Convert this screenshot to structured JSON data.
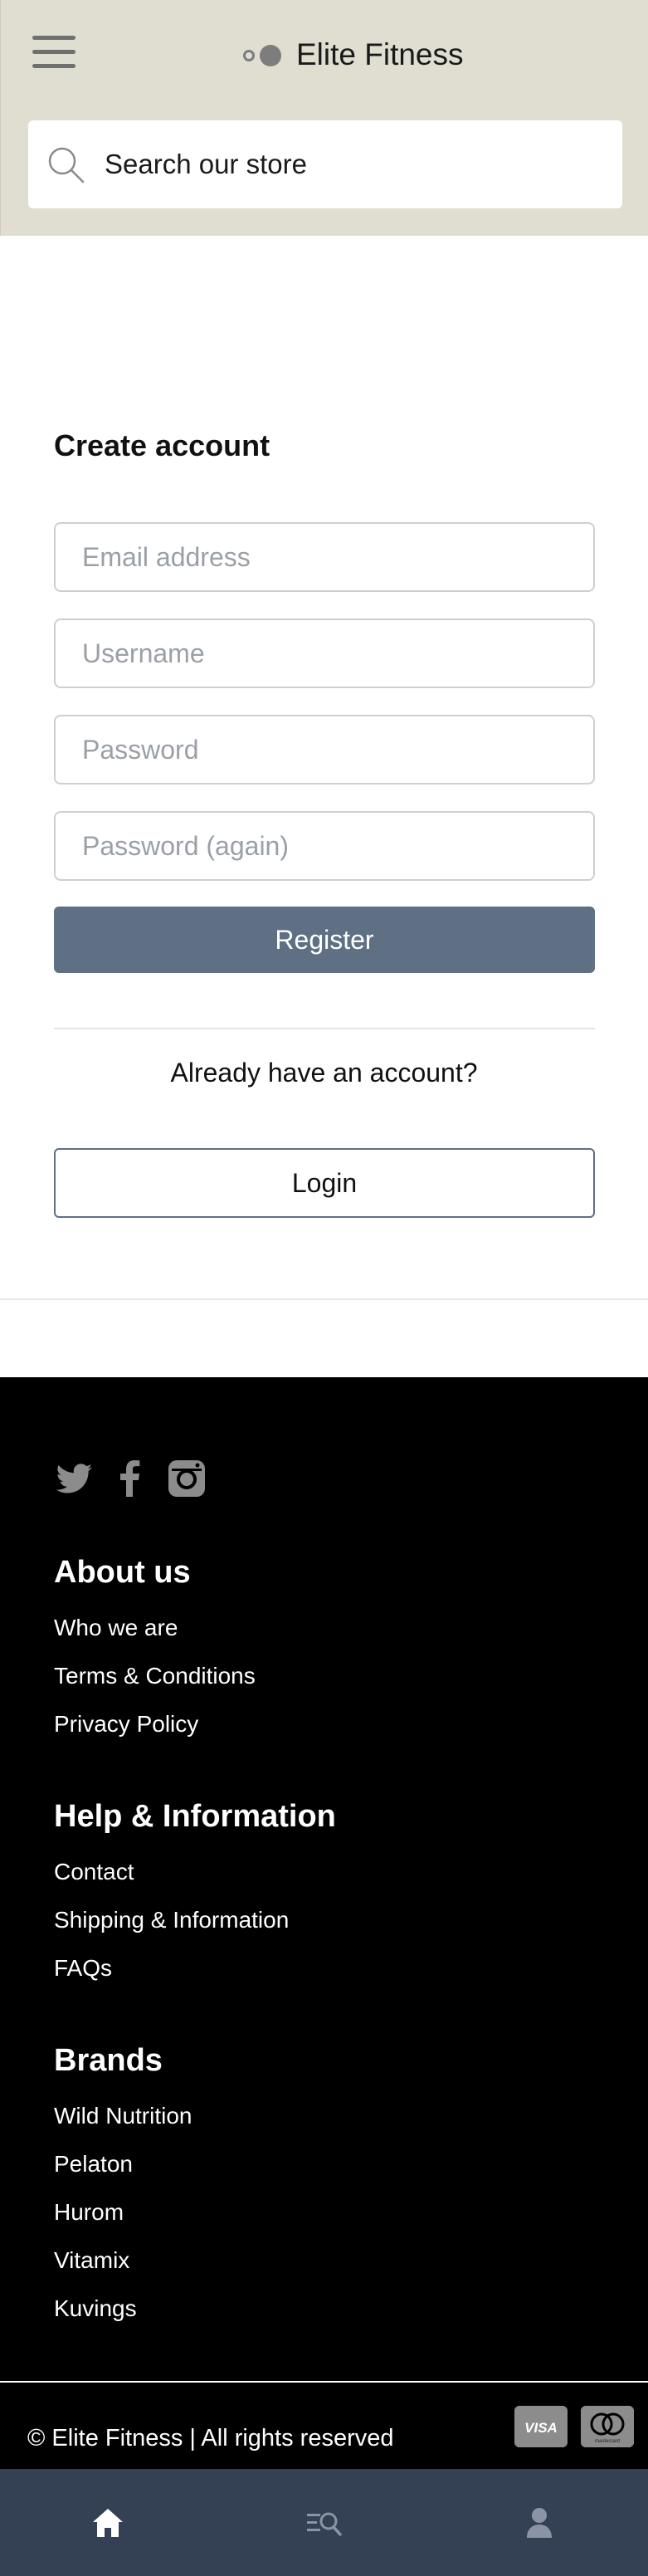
{
  "header": {
    "menu_icon": "hamburger-menu-icon",
    "brand_name": "Elite Fitness",
    "logo_icon": "two-circles-logo-icon",
    "search": {
      "placeholder": "Search our store",
      "icon": "search-icon"
    },
    "background_color": "#e0ddd1"
  },
  "account": {
    "title": "Create account",
    "fields": {
      "email_placeholder": "Email address",
      "username_placeholder": "Username",
      "password_placeholder": "Password",
      "password_again_placeholder": "Password (again)"
    },
    "register_label": "Register",
    "already_text": "Already have an account?",
    "login_label": "Login",
    "accent_color": "#5f6f84"
  },
  "footer": {
    "social_icons": [
      "twitter-icon",
      "facebook-icon",
      "instagram-icon"
    ],
    "sections": [
      {
        "title": "About us",
        "links": [
          "Who we are",
          "Terms & Conditions",
          "Privacy Policy"
        ]
      },
      {
        "title": "Help & Information",
        "links": [
          "Contact",
          "Shipping & Information",
          "FAQs"
        ]
      },
      {
        "title": "Brands",
        "links": [
          "Wild Nutrition",
          "Pelaton",
          "Hurom",
          "Vitamix",
          "Kuvings"
        ]
      }
    ],
    "copyright": "© Elite Fitness | All rights reserved",
    "payment_icons": [
      "visa-icon",
      "mastercard-icon"
    ],
    "visa_text": "VISA",
    "mastercard_text": "mastercard"
  },
  "bottom_nav": {
    "items": [
      "home-icon",
      "browse-search-icon",
      "account-icon"
    ],
    "background_color": "#344155"
  }
}
